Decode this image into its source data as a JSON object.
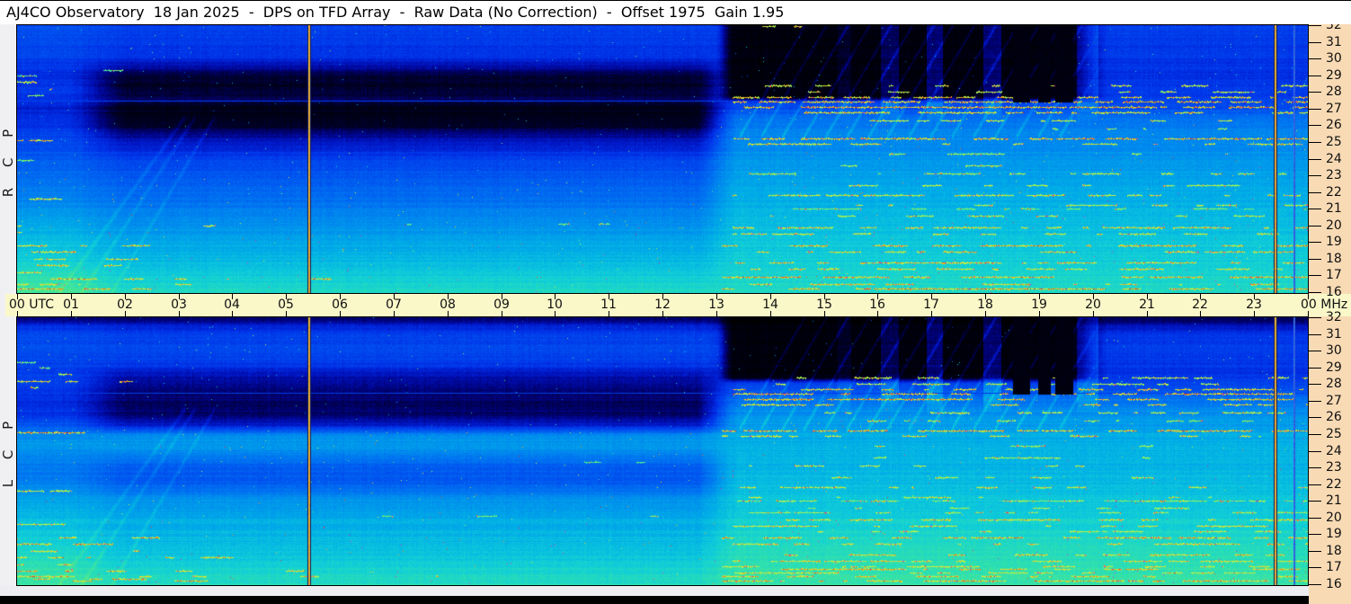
{
  "title": "AJ4CO Observatory  18 Jan 2025  -  DPS on TFD Array  -  Raw Data (No Correction)  -  Offset 1975  Gain 1.95",
  "panels": [
    {
      "id": "RCP",
      "label": "R C P"
    },
    {
      "id": "LCP",
      "label": "L C P"
    }
  ],
  "time_axis": {
    "start_label": "00 UTC",
    "hour_labels": [
      "00",
      "01",
      "02",
      "03",
      "04",
      "05",
      "06",
      "07",
      "08",
      "09",
      "10",
      "11",
      "12",
      "13",
      "14",
      "15",
      "16",
      "17",
      "18",
      "19",
      "20",
      "21",
      "22",
      "23"
    ],
    "end_label": "00 MHz",
    "unit": "MHz"
  },
  "freq_axis": {
    "unit": "MHz",
    "labels": [
      "32",
      "31",
      "30",
      "29",
      "28",
      "27",
      "26",
      "25",
      "24",
      "23",
      "22",
      "21",
      "20",
      "19",
      "18",
      "17",
      "16"
    ]
  },
  "colors": {
    "title_bg": "#ffffff",
    "band_bg": "#faf8c9",
    "freq_strip_bg": "#f8dab4",
    "page_bg": "#f0f0f2",
    "frame": "#000000",
    "footer_bar": "#000000",
    "marker_orange": "#e8b03c",
    "marker_blue": "#2e5cf0"
  },
  "chart_data": {
    "type": "heatmap",
    "title": "AJ4CO Observatory dynamic power spectrum, 18 Jan 2025, TFD Array, raw data",
    "x": {
      "label": "UTC",
      "range_hours": [
        0,
        24
      ],
      "ticks": [
        "00",
        "01",
        "02",
        "03",
        "04",
        "05",
        "06",
        "07",
        "08",
        "09",
        "10",
        "11",
        "12",
        "13",
        "14",
        "15",
        "16",
        "17",
        "18",
        "19",
        "20",
        "21",
        "22",
        "23",
        "00"
      ]
    },
    "y": {
      "label": "MHz",
      "range_mhz": [
        16,
        32
      ],
      "ticks": [
        32,
        31,
        30,
        29,
        28,
        27,
        26,
        25,
        24,
        23,
        22,
        21,
        20,
        19,
        18,
        17,
        16
      ]
    },
    "legend_position": "none",
    "grid": false,
    "colormap_stops": [
      [
        0.0,
        "#000000"
      ],
      [
        0.08,
        "#000020"
      ],
      [
        0.14,
        "#000070"
      ],
      [
        0.2,
        "#0010b8"
      ],
      [
        0.27,
        "#0030e8"
      ],
      [
        0.34,
        "#0055f0"
      ],
      [
        0.42,
        "#0080f0"
      ],
      [
        0.5,
        "#00aae8"
      ],
      [
        0.58,
        "#10cfd8"
      ],
      [
        0.65,
        "#2ee0b0"
      ],
      [
        0.72,
        "#55e888"
      ],
      [
        0.78,
        "#8ef25e"
      ],
      [
        0.84,
        "#c8f03a"
      ],
      [
        0.88,
        "#f2e428"
      ],
      [
        0.92,
        "#f8a81e"
      ],
      [
        0.955,
        "#f05515"
      ],
      [
        0.98,
        "#e82a28"
      ],
      [
        1.0,
        "#e431b4"
      ]
    ],
    "profile_format": "[freq_mhz, intensity_0_to_1] stops, early = 00:00-01:00, mid = 02:00-12:30, late = 13:30-24:00",
    "panels": [
      {
        "name": "RCP",
        "seed": 7,
        "dark_top_fmin": 27.3,
        "profiles": {
          "early": [
            [
              32,
              0.33
            ],
            [
              31,
              0.32
            ],
            [
              30,
              0.3
            ],
            [
              29,
              0.26
            ],
            [
              28,
              0.28
            ],
            [
              27,
              0.24
            ],
            [
              26,
              0.27
            ],
            [
              25,
              0.32
            ],
            [
              24,
              0.35
            ],
            [
              23,
              0.38
            ],
            [
              22,
              0.41
            ],
            [
              21,
              0.45
            ],
            [
              20,
              0.5
            ],
            [
              19,
              0.54
            ],
            [
              18,
              0.58
            ],
            [
              17,
              0.64
            ],
            [
              16,
              0.7
            ]
          ],
          "mid": [
            [
              32,
              0.3
            ],
            [
              31,
              0.29
            ],
            [
              30,
              0.26
            ],
            [
              29.4,
              0.16
            ],
            [
              29,
              0.1
            ],
            [
              28.4,
              0.07
            ],
            [
              28,
              0.09
            ],
            [
              27.6,
              0.12
            ],
            [
              27.2,
              0.07
            ],
            [
              26.6,
              0.05
            ],
            [
              26,
              0.08
            ],
            [
              25.4,
              0.16
            ],
            [
              25,
              0.22
            ],
            [
              24,
              0.3
            ],
            [
              23,
              0.34
            ],
            [
              22,
              0.37
            ],
            [
              21,
              0.41
            ],
            [
              20,
              0.45
            ],
            [
              19,
              0.49
            ],
            [
              18,
              0.53
            ],
            [
              17,
              0.575
            ],
            [
              16,
              0.62
            ]
          ],
          "late": [
            [
              32,
              0.3
            ],
            [
              31,
              0.29
            ],
            [
              30,
              0.28
            ],
            [
              29,
              0.27
            ],
            [
              28,
              0.28
            ],
            [
              27.5,
              0.3
            ],
            [
              27,
              0.33
            ],
            [
              26.5,
              0.38
            ],
            [
              26,
              0.41
            ],
            [
              25,
              0.44
            ],
            [
              24,
              0.46
            ],
            [
              23,
              0.48
            ],
            [
              22,
              0.5
            ],
            [
              21,
              0.52
            ],
            [
              20,
              0.54
            ],
            [
              19,
              0.56
            ],
            [
              18,
              0.58
            ],
            [
              17,
              0.6
            ],
            [
              16,
              0.62
            ]
          ]
        },
        "extra_lines": [
          [
            31.95,
            13.85,
            14.6,
            0.82,
            0.85,
            0
          ]
        ]
      },
      {
        "name": "LCP",
        "seed": 13,
        "dark_top_fmin": 28.0,
        "profiles": {
          "early": [
            [
              32,
              0.14
            ],
            [
              31.5,
              0.26
            ],
            [
              31,
              0.32
            ],
            [
              30,
              0.33
            ],
            [
              29,
              0.3
            ],
            [
              28,
              0.29
            ],
            [
              27,
              0.26
            ],
            [
              26,
              0.28
            ],
            [
              25.2,
              0.4
            ],
            [
              24.5,
              0.47
            ],
            [
              23.5,
              0.42
            ],
            [
              22.5,
              0.4
            ],
            [
              21.5,
              0.46
            ],
            [
              20.5,
              0.52
            ],
            [
              19.5,
              0.55
            ],
            [
              18.5,
              0.58
            ],
            [
              17.5,
              0.63
            ],
            [
              16,
              0.68
            ]
          ],
          "mid": [
            [
              32,
              0.13
            ],
            [
              31.6,
              0.22
            ],
            [
              31,
              0.3
            ],
            [
              30,
              0.32
            ],
            [
              29.4,
              0.3
            ],
            [
              29,
              0.26
            ],
            [
              28.4,
              0.18
            ],
            [
              28,
              0.16
            ],
            [
              27.4,
              0.14
            ],
            [
              27,
              0.13
            ],
            [
              26.4,
              0.13
            ],
            [
              26,
              0.15
            ],
            [
              25.6,
              0.22
            ],
            [
              25.2,
              0.36
            ],
            [
              24.8,
              0.46
            ],
            [
              24.2,
              0.46
            ],
            [
              23.6,
              0.4
            ],
            [
              23,
              0.35
            ],
            [
              22.4,
              0.34
            ],
            [
              22,
              0.36
            ],
            [
              21.4,
              0.42
            ],
            [
              21,
              0.46
            ],
            [
              20,
              0.5
            ],
            [
              19,
              0.52
            ],
            [
              18,
              0.55
            ],
            [
              17,
              0.59
            ],
            [
              16,
              0.63
            ]
          ],
          "late": [
            [
              32,
              0.12
            ],
            [
              31,
              0.28
            ],
            [
              30,
              0.3
            ],
            [
              29.2,
              0.28
            ],
            [
              28.6,
              0.27
            ],
            [
              28,
              0.3
            ],
            [
              27.4,
              0.36
            ],
            [
              27,
              0.4
            ],
            [
              26.4,
              0.44
            ],
            [
              26,
              0.46
            ],
            [
              25,
              0.5
            ],
            [
              24,
              0.52
            ],
            [
              23,
              0.52
            ],
            [
              22,
              0.54
            ],
            [
              21,
              0.56
            ],
            [
              20,
              0.58
            ],
            [
              19,
              0.6
            ],
            [
              18,
              0.63
            ],
            [
              17,
              0.65
            ],
            [
              16,
              0.67
            ]
          ]
        },
        "extra_lines": [
          [
            25.0,
            0,
            1.5,
            0.9,
            0.6,
            1
          ],
          [
            16.35,
            0,
            8,
            0.9,
            0.55,
            1
          ],
          [
            21.0,
            13.3,
            24,
            0.66,
            0.4,
            0
          ],
          [
            20.3,
            13.6,
            24,
            0.64,
            0.35,
            0
          ],
          [
            19.2,
            13.3,
            24,
            0.72,
            0.45,
            0
          ],
          [
            17.1,
            13.1,
            24,
            0.8,
            0.5,
            0
          ],
          [
            16.7,
            13.1,
            24,
            0.8,
            0.5,
            0
          ]
        ]
      }
    ],
    "lines_format": "[freq_mhz, t_start_h, t_end_h, amplitude, density, fade_out]",
    "lines": [
      [
        29.3,
        0,
        2.6,
        0.45,
        0.4,
        1
      ],
      [
        29.0,
        0,
        2.3,
        0.5,
        0.45,
        1
      ],
      [
        28.6,
        0,
        1.9,
        0.8,
        0.55,
        1
      ],
      [
        28.2,
        0,
        2.9,
        0.85,
        0.5,
        1
      ],
      [
        27.8,
        0.2,
        1.5,
        0.6,
        0.45,
        1
      ],
      [
        25.1,
        0,
        1.7,
        0.95,
        0.75,
        1
      ],
      [
        23.9,
        0,
        1.2,
        0.55,
        0.35,
        1
      ],
      [
        21.6,
        0,
        2.3,
        0.75,
        0.45,
        1
      ],
      [
        20.0,
        0,
        3.9,
        0.8,
        0.5,
        1
      ],
      [
        19.6,
        0,
        3.1,
        0.75,
        0.45,
        1
      ],
      [
        18.8,
        0,
        6.9,
        0.9,
        0.55,
        1
      ],
      [
        18.4,
        0,
        5.6,
        0.92,
        0.6,
        1
      ],
      [
        18.0,
        0,
        4.1,
        0.82,
        0.5,
        1
      ],
      [
        17.6,
        0,
        5.1,
        0.88,
        0.6,
        1
      ],
      [
        17.2,
        0,
        4.3,
        0.84,
        0.55,
        1
      ],
      [
        16.8,
        0,
        9.2,
        0.9,
        0.5,
        1
      ],
      [
        16.5,
        0,
        13.2,
        0.85,
        0.4,
        1
      ],
      [
        16.2,
        0,
        7.1,
        0.92,
        0.65,
        1
      ],
      [
        20.1,
        5.5,
        12.6,
        0.5,
        0.08,
        0
      ],
      [
        23.3,
        7,
        12,
        0.4,
        0.05,
        0
      ],
      [
        28.4,
        13.9,
        24,
        0.78,
        0.4,
        0
      ],
      [
        28.0,
        14.1,
        24,
        0.72,
        0.35,
        0
      ],
      [
        27.7,
        13.3,
        24,
        0.88,
        0.65,
        0
      ],
      [
        27.4,
        13.3,
        24,
        0.94,
        0.8,
        0
      ],
      [
        27.1,
        13.5,
        24,
        0.96,
        0.82,
        0
      ],
      [
        26.8,
        13.3,
        24,
        0.88,
        0.6,
        0
      ],
      [
        26.3,
        14.6,
        23.6,
        0.75,
        0.35,
        0
      ],
      [
        25.8,
        15,
        23,
        0.65,
        0.25,
        0
      ],
      [
        25.2,
        13.1,
        24,
        0.94,
        0.75,
        0
      ],
      [
        24.9,
        13.1,
        24,
        0.82,
        0.5,
        0
      ],
      [
        24.3,
        14.6,
        22.6,
        0.65,
        0.25,
        0
      ],
      [
        23.6,
        14,
        23,
        0.65,
        0.3,
        0
      ],
      [
        23.1,
        13.6,
        23.6,
        0.7,
        0.35,
        0
      ],
      [
        22.4,
        14,
        23.2,
        0.7,
        0.35,
        0
      ],
      [
        21.8,
        13.3,
        24,
        0.76,
        0.45,
        0
      ],
      [
        21.2,
        13.6,
        24,
        0.72,
        0.4,
        0
      ],
      [
        21.0,
        13.4,
        24,
        0.5,
        0.55,
        0
      ],
      [
        20.6,
        14,
        23.2,
        0.66,
        0.3,
        0
      ],
      [
        19.9,
        13.3,
        24,
        0.86,
        0.55,
        0
      ],
      [
        19.5,
        13.3,
        24,
        0.8,
        0.5,
        0
      ],
      [
        18.8,
        13.1,
        24,
        0.92,
        0.65,
        0
      ],
      [
        18.4,
        13.3,
        24,
        0.86,
        0.55,
        0
      ],
      [
        17.8,
        13.1,
        24,
        0.88,
        0.6,
        0
      ],
      [
        17.4,
        13.3,
        24,
        0.82,
        0.55,
        0
      ],
      [
        16.9,
        13.1,
        24,
        0.94,
        0.65,
        0
      ],
      [
        16.5,
        13.1,
        24,
        0.88,
        0.6,
        0
      ],
      [
        16.2,
        13.1,
        24,
        0.94,
        0.7,
        0
      ]
    ],
    "floor_lines": [
      {
        "f": 27.45,
        "level": 0.3
      }
    ],
    "vlines": [
      {
        "t": 5.41,
        "style": "orange"
      },
      {
        "t": 23.38,
        "style": "orange"
      },
      {
        "t": 23.73,
        "style": "blue"
      },
      {
        "t": 13.92,
        "style": "glow",
        "amp": 0.12
      }
    ],
    "dropout_fmin": 27.4,
    "dropout_columns": [
      [
        18.52,
        18.84
      ],
      [
        18.98,
        19.22
      ],
      [
        19.3,
        19.64
      ]
    ],
    "bright_columns": [
      [
        15.25,
        15.5,
        0.05
      ],
      [
        16.05,
        16.38,
        0.09
      ],
      [
        16.9,
        17.2,
        0.11
      ],
      [
        17.95,
        18.3,
        0.11
      ],
      [
        19.7,
        20.1,
        0.09
      ]
    ],
    "diag_streaks": {
      "slope": 5.5,
      "amp": 0.085,
      "t0": [
        13.55,
        13.95,
        14.35,
        14.75,
        15.15,
        15.55,
        15.95,
        16.3,
        16.7,
        17.1,
        17.5,
        17.9,
        18.3,
        18.7,
        19.1,
        19.5
      ]
    },
    "early_wisps": {
      "amp": 0.05,
      "list": [
        [
          1.0,
          17,
          4.5
        ],
        [
          1.6,
          18,
          5
        ],
        [
          2.3,
          19,
          5.5
        ]
      ]
    }
  }
}
